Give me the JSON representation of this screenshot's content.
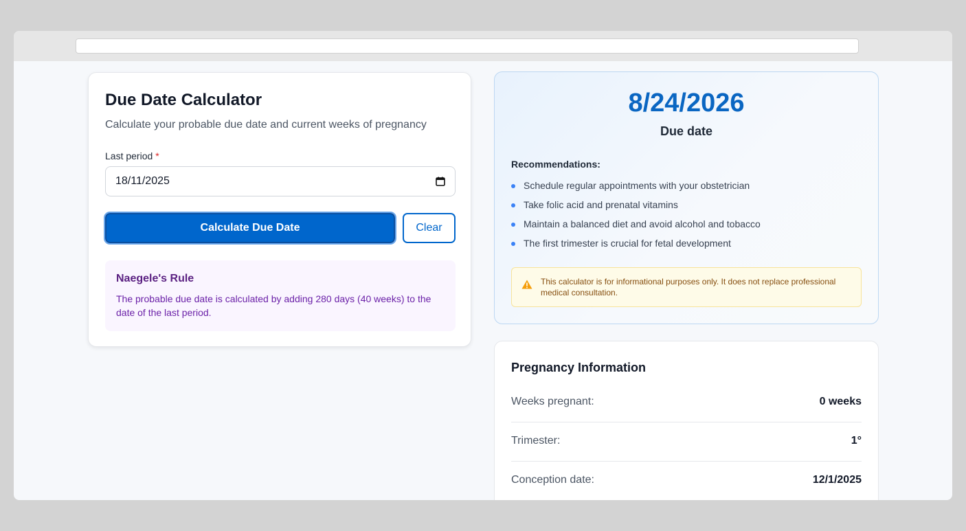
{
  "calculator": {
    "title": "Due Date Calculator",
    "subtitle": "Calculate your probable due date and current weeks of pregnancy",
    "last_period_label": "Last period",
    "required_marker": "*",
    "last_period_value": "18/11/2025",
    "calculate_label": "Calculate Due Date",
    "clear_label": "Clear",
    "rule": {
      "title": "Naegele's Rule",
      "text": "The probable due date is calculated by adding 280 days (40 weeks) to the date of the last period."
    }
  },
  "result": {
    "due_date": "8/24/2026",
    "due_label": "Due date",
    "recommendations_title": "Recommendations:",
    "recommendations": [
      "Schedule regular appointments with your obstetrician",
      "Take folic acid and prenatal vitamins",
      "Maintain a balanced diet and avoid alcohol and tobacco",
      "The first trimester is crucial for fetal development"
    ],
    "warning": "This calculator is for informational purposes only. It does not replace professional medical consultation."
  },
  "pregnancy_info": {
    "title": "Pregnancy Information",
    "rows": [
      {
        "label": "Weeks pregnant:",
        "value": "0 weeks"
      },
      {
        "label": "Trimester:",
        "value": "1°"
      },
      {
        "label": "Conception date:",
        "value": "12/1/2025"
      }
    ]
  },
  "colors": {
    "primary": "#0066cc",
    "due_date": "#0a66c2",
    "rule_bg": "#faf5ff",
    "warning_bg": "#fefbe8"
  },
  "icons": {
    "calendar": "calendar-icon",
    "warning": "warning-icon"
  }
}
